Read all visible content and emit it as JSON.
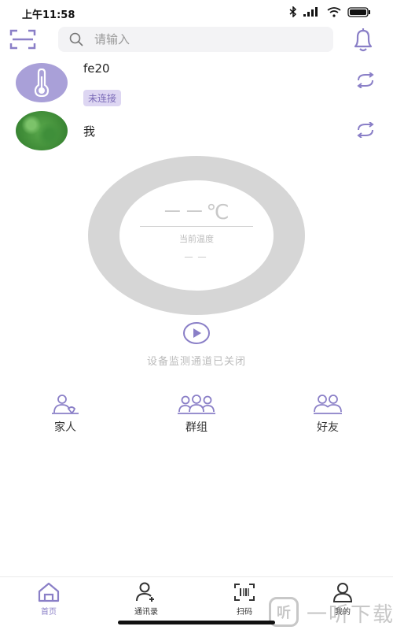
{
  "status_bar": {
    "time": "上午11:58",
    "icons": [
      "bluetooth-icon",
      "signal-icon",
      "wifi-icon",
      "battery-icon"
    ]
  },
  "header": {
    "search_placeholder": "请输入",
    "icons": [
      "scan-icon",
      "search-icon",
      "bell-icon"
    ]
  },
  "devices": [
    {
      "name": "fe20",
      "status": "未连接",
      "avatar": "thermometer-avatar",
      "action_icon": "refresh-icon"
    },
    {
      "name": "我",
      "status": "",
      "avatar": "grass-photo-avatar",
      "action_icon": "refresh-icon"
    }
  ],
  "gauge": {
    "temperature": "－－℃",
    "label": "当前温度",
    "sub_value": "－－"
  },
  "monitor": {
    "play_icon": "play-icon",
    "status": "设备监测通道已关闭"
  },
  "groups": [
    {
      "label": "家人",
      "icon": "family-icon"
    },
    {
      "label": "群组",
      "icon": "group-icon"
    },
    {
      "label": "好友",
      "icon": "friends-icon"
    }
  ],
  "tabs": [
    {
      "label": "首页",
      "icon": "home-icon",
      "active": true
    },
    {
      "label": "通讯录",
      "icon": "contacts-icon",
      "active": false
    },
    {
      "label": "扫码",
      "icon": "scan-code-icon",
      "active": false
    },
    {
      "label": "我的",
      "icon": "profile-icon",
      "active": false
    }
  ],
  "watermark": {
    "logo": "听",
    "text": "一听下载"
  },
  "colors": {
    "accent": "#8a7fc7",
    "tag_bg": "#ddd6f2",
    "ring": "#d6d6d6",
    "thermometer_avatar": "#a9a0d8"
  }
}
